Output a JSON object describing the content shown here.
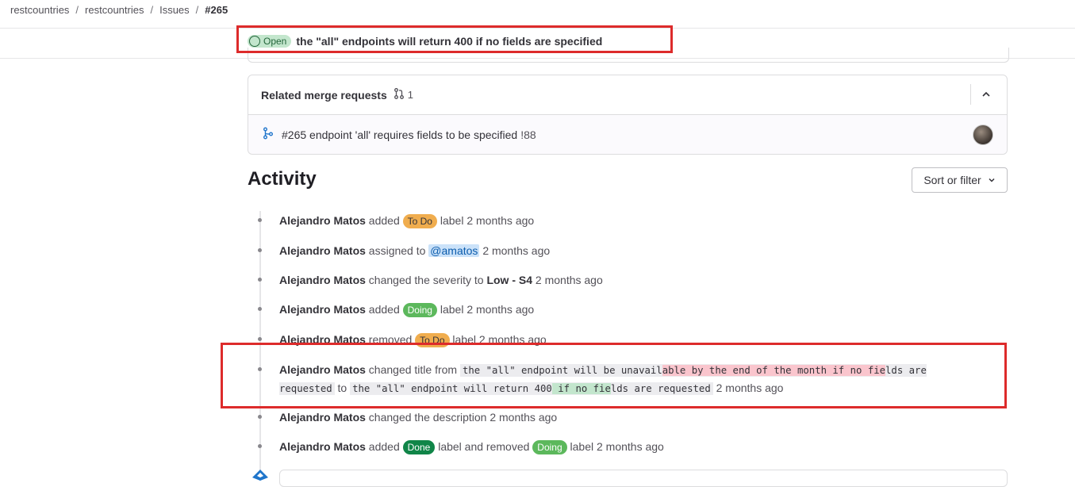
{
  "breadcrumb": {
    "items": [
      "restcountries",
      "restcountries",
      "Issues"
    ],
    "current": "#265",
    "separator": "/"
  },
  "issue": {
    "status": "Open",
    "title": "the \"all\" endpoints will return 400 if no fields are specified"
  },
  "related_mrs": {
    "title": "Related merge requests",
    "count": "1",
    "items": [
      {
        "text": "#265 endpoint 'all' requires fields to be specified",
        "ref": "!88"
      }
    ]
  },
  "activity": {
    "title": "Activity",
    "sort_label": "Sort or filter",
    "items": [
      {
        "author": "Alejandro Matos",
        "a": "added",
        "label": "To Do",
        "b": "label 2 months ago"
      },
      {
        "author": "Alejandro Matos",
        "a": "assigned to",
        "mention": "@amatos",
        "b": "2 months ago"
      },
      {
        "author": "Alejandro Matos",
        "a": "changed the severity to",
        "strong": "Low - S4",
        "b": "2 months ago"
      },
      {
        "author": "Alejandro Matos",
        "a": "added",
        "label": "Doing",
        "b": "label 2 months ago"
      },
      {
        "author": "Alejandro Matos",
        "a": "removed",
        "label": "To Do",
        "b": "label 2 months ago"
      },
      {
        "author": "Alejandro Matos",
        "a": "changed title from",
        "old_pre": "the \"all\" endpoint will be unavail",
        "old_del": "able by the end of the month if no fie",
        "old_post": "lds are",
        "old_post2": "requested",
        "to": "to",
        "new_pre": "the \"all\" endpoint will return 400",
        "new_ins": " if no fie",
        "new_post": "lds are requested",
        "b": "2 months ago"
      },
      {
        "author": "Alejandro Matos",
        "a": "changed the description 2 months ago"
      },
      {
        "author": "Alejandro Matos",
        "a": "added",
        "label": "Done",
        "mid": "label and removed",
        "label2": "Doing",
        "b": "label 2 months ago"
      }
    ]
  },
  "colors": {
    "highlight_box": "#dd2b2b",
    "open_badge_bg": "#c3e6cd",
    "todo": "#f0ad4e",
    "doing": "#5cb85c",
    "done": "#108548"
  }
}
